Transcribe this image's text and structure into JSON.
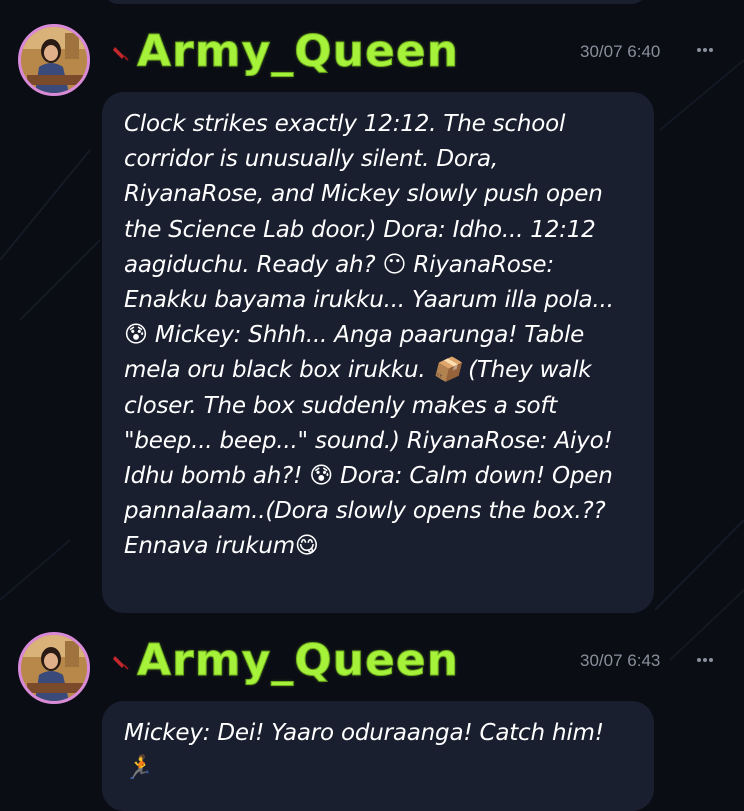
{
  "messages": [
    {
      "author": "Army_Queen",
      "timestamp": "30/07 6:40",
      "text": "Clock strikes exactly 12:12. The school corridor is unusually silent. Dora, RiyanaRose, and Mickey slowly push open the Science Lab door.) Dora: Idho... 12:12 aagiduchu. Ready ah? 😶 RiyanaRose: Enakku bayama irukku... Yaarum illa pola... 😰 Mickey: Shhh... Anga paarunga! Table mela oru black box irukku. 📦 (They walk closer. The box suddenly makes a soft \"beep... beep...\" sound.) RiyanaRose: Aiyo! Idhu bomb ah?! 😰 Dora: Calm down! Open pannalaam..(Dora slowly opens the box.?? Ennava irukum😋"
    },
    {
      "author": "Army_Queen",
      "timestamp": "30/07 6:43",
      "text": "Mickey: Dei! Yaaro oduraanga! Catch him! 🏃"
    }
  ],
  "icons": {
    "badge": "rocket-icon",
    "more": "more-options-icon"
  },
  "colors": {
    "background": "#0b0d14",
    "bubble": "#1a1f30",
    "username": "#a6f23a",
    "avatar_ring": "#d88ad8",
    "timestamp": "#8a8f9c",
    "message_text": "#ffffff"
  }
}
